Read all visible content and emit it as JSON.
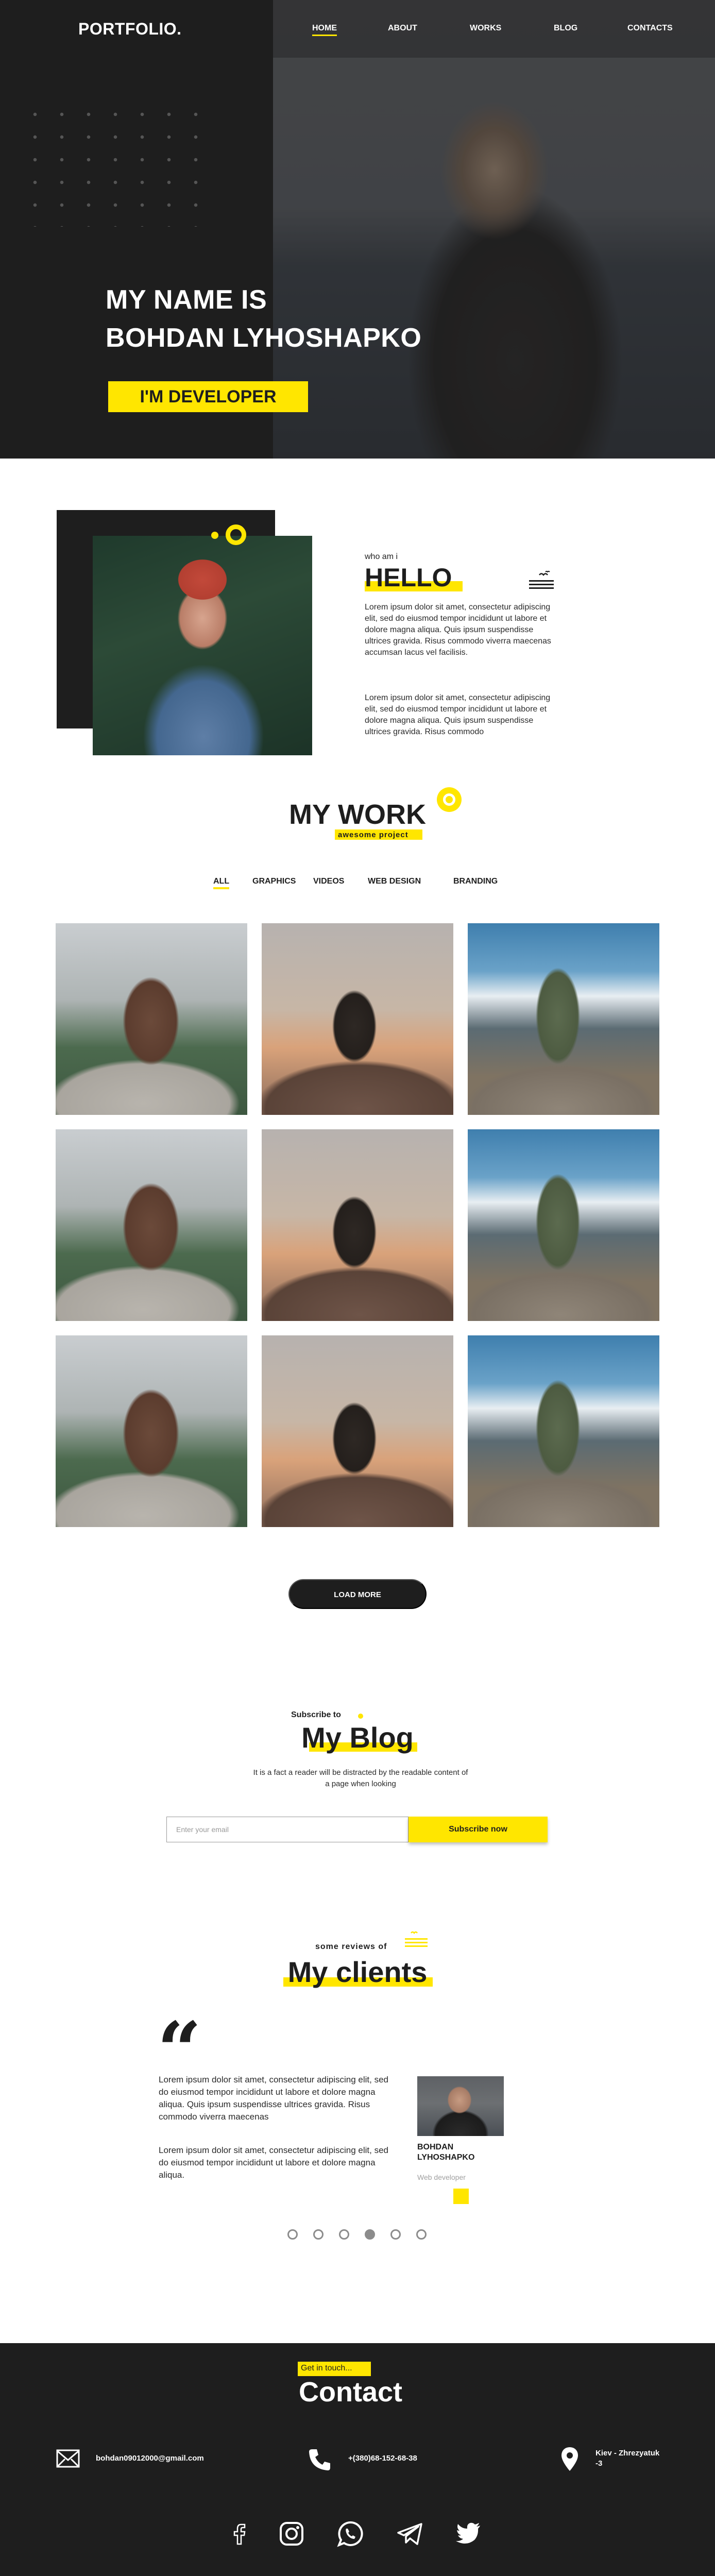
{
  "header": {
    "logo": "PORTFOLIO.",
    "nav": [
      {
        "label": "HOME",
        "active": true
      },
      {
        "label": "ABOUT"
      },
      {
        "label": "WORKS"
      },
      {
        "label": "BLOG"
      },
      {
        "label": "CONTACTS"
      }
    ]
  },
  "hero": {
    "line1": "MY NAME IS",
    "line2": "BOHDAN LYHOSHAPKO",
    "badge": "I'M DEVELOPER",
    "photo_icon": "photographer-photo"
  },
  "about": {
    "label": "who am i",
    "title": "HELLO",
    "paragraph1": "Lorem ipsum dolor sit amet, consectetur adipiscing elit, sed do eiusmod tempor incididunt ut labore et dolore magna aliqua. Quis ipsum suspendisse ultrices gravida. Risus commodo viverra maecenas accumsan lacus vel facilisis.",
    "paragraph2": "Lorem ipsum dolor sit amet, consectetur adipiscing elit, sed do eiusmod tempor incididunt ut labore et dolore magna aliqua. Quis ipsum suspendisse ultrices gravida. Risus commodo",
    "icon": "birds-icon"
  },
  "work": {
    "title": "MY WORK",
    "subtitle": "awesome project",
    "filters": [
      {
        "label": "ALL",
        "active": true
      },
      {
        "label": "GRAPHICS"
      },
      {
        "label": "VIDEOS"
      },
      {
        "label": "WEB DESIGN"
      },
      {
        "label": "BRANDING"
      }
    ],
    "tiles": [
      "girl-on-cliff-photo",
      "girl-at-sunset-photo",
      "hiker-mountains-photo"
    ],
    "load_more": "LOAD MORE"
  },
  "blog": {
    "label": "Subscribe to",
    "title": "My Blog",
    "text": "It is a fact a reader will be distracted by the readable content of a page when looking",
    "email_placeholder": "Enter your email",
    "button": "Subscribe now"
  },
  "clients": {
    "label": "some reviews of",
    "title": "My clients",
    "quote_mark": "“",
    "review1": "Lorem ipsum dolor sit amet, consectetur adipiscing elit, sed do eiusmod tempor incididunt ut labore et dolore magna aliqua. Quis ipsum suspendisse ultrices gravida. Risus commodo viverra maecenas",
    "review2": "Lorem ipsum dolor sit amet, consectetur adipiscing elit, sed do eiusmod tempor incididunt ut labore et dolore magna aliqua.",
    "client_name": "BOHDAN LYHOSHAPKO",
    "client_role": "Web developer",
    "slides": 6,
    "active_slide": 4
  },
  "contact": {
    "tag": "Get in touch...",
    "title": "Contact",
    "email": "bohdan09012000@gmail.com",
    "phone": "+(380)68-152-68-38",
    "location": "Kiev - Zhrezyatuk -3",
    "socials": [
      "facebook-icon",
      "instagram-icon",
      "whatsapp-icon",
      "telegram-icon",
      "twitter-icon"
    ]
  },
  "colors": {
    "accent": "#ffe600",
    "dark": "#1e1e1e",
    "white": "#ffffff"
  }
}
